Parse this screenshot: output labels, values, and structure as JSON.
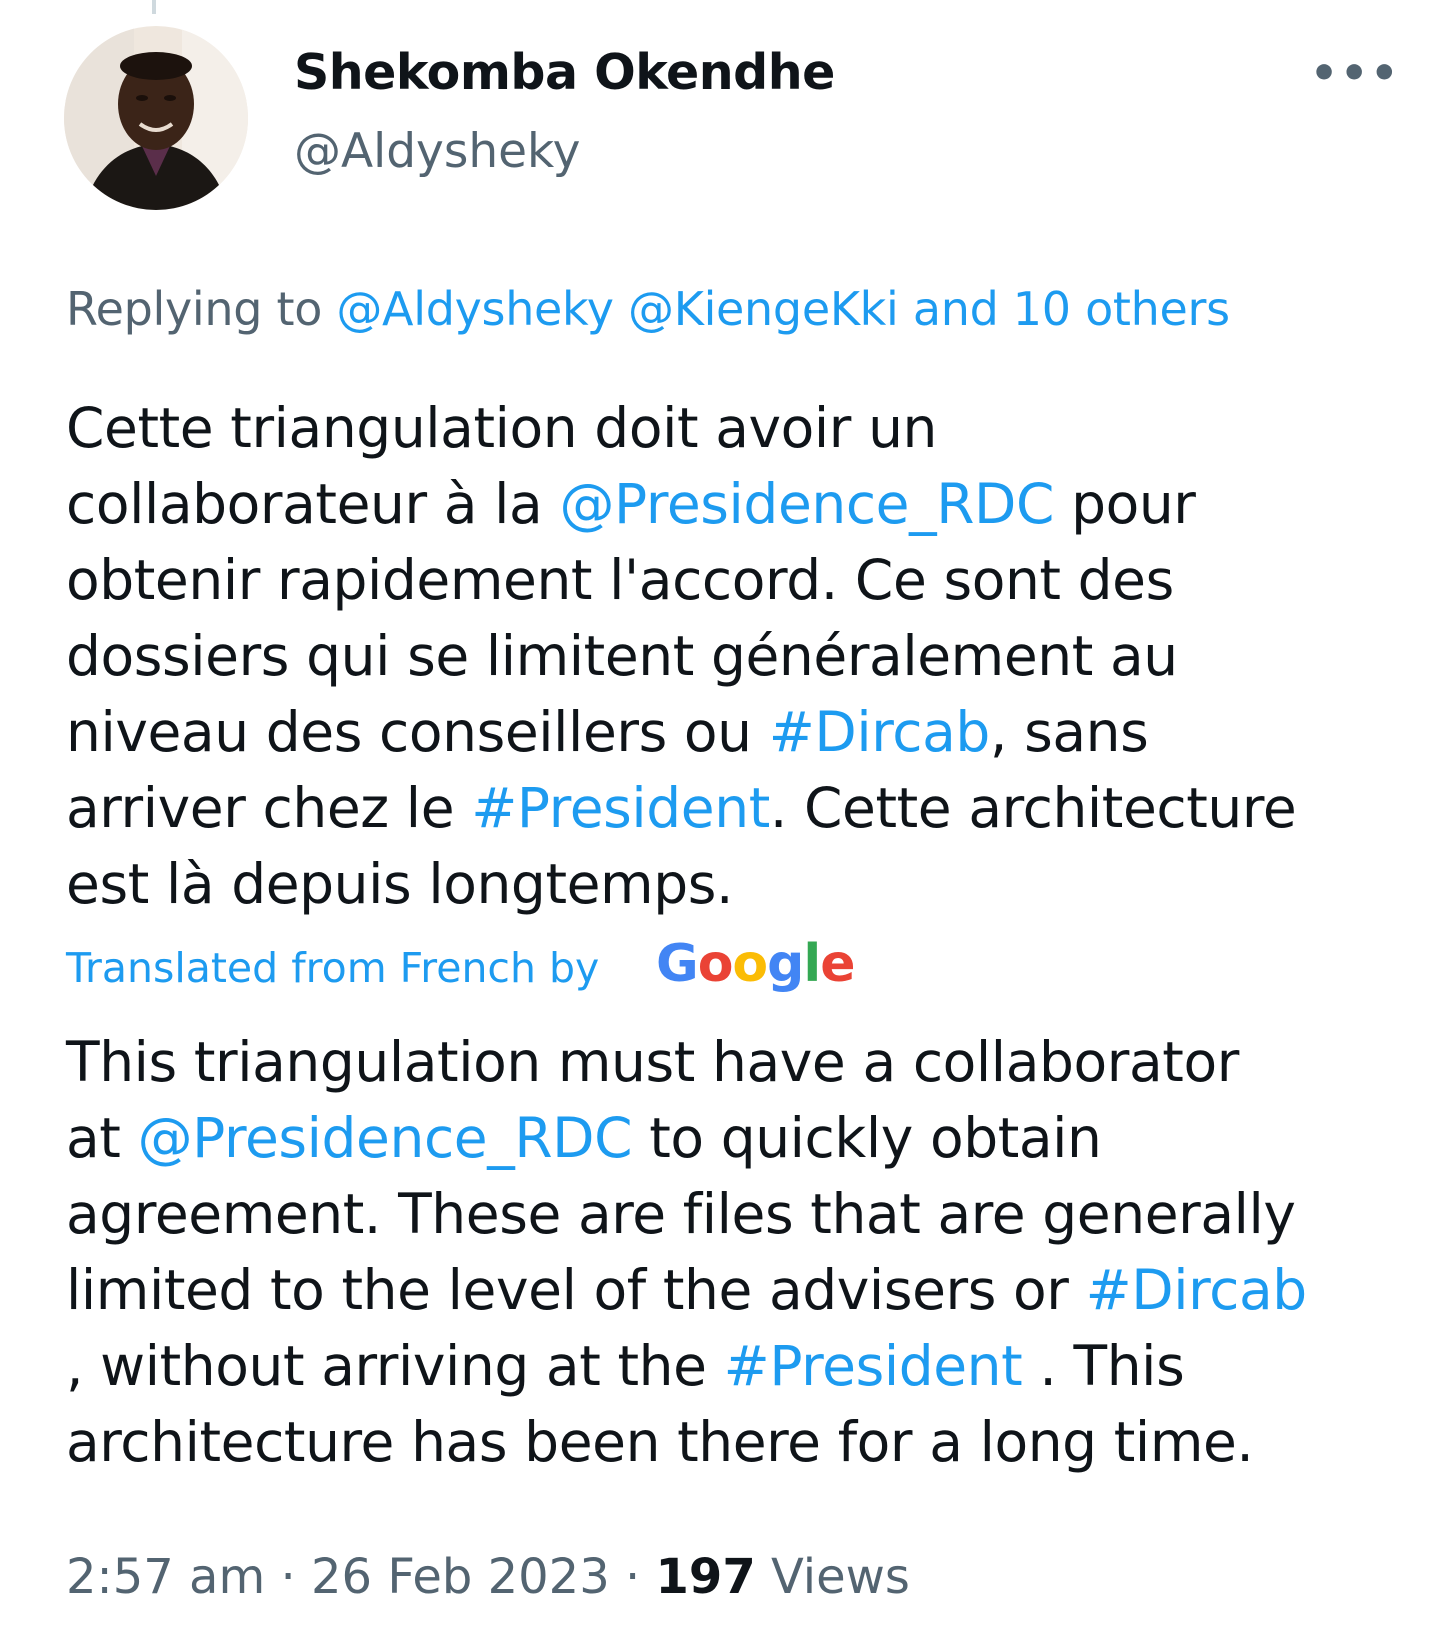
{
  "tweet": {
    "author_name": "Shekomba Okendhe",
    "author_handle": "@Aldysheky",
    "more_icon": "more-horizontal-icon",
    "replying": {
      "prefix": "Replying to ",
      "mention_1": "@Aldysheky",
      "mention_2": "@KiengeKki",
      "others": " and 10 others"
    },
    "original": {
      "l1": "Cette triangulation doit avoir un",
      "l2a": "collaborateur à la ",
      "l2b": "@Presidence_RDC",
      "l2c": " pour",
      "l3": "obtenir rapidement l'accord. Ce sont des",
      "l4": "dossiers qui se limitent généralement au",
      "l5a": "niveau des conseillers ou ",
      "l5b": "#Dircab",
      "l5c": ", sans",
      "l6a": "arriver chez le ",
      "l6b": "#President",
      "l6c": ". Cette architecture",
      "l7": "est là depuis longtemps."
    },
    "translated_label": "Translated from French by",
    "translator_logo": "Google",
    "translation": {
      "l1": "This triangulation must have a collaborator",
      "l2a": "at ",
      "l2b": "@Presidence_RDC",
      "l2c": " to quickly obtain",
      "l3": "agreement. These are files that are generally",
      "l4a": "limited to the level of the advisers or ",
      "l4b": "#Dircab",
      "l5a": ", without arriving at the ",
      "l5b": "#President",
      "l5c": " . This",
      "l6": "architecture has been there for a long time."
    },
    "time": "2:57 am",
    "separator": " · ",
    "date": "26 Feb 2023",
    "views_count": "197",
    "views_label": " Views"
  },
  "colors": {
    "link": "#1d9bf0",
    "secondary_text": "#536471",
    "primary_text": "#0f1419",
    "google_blue": "#4285f4",
    "google_red": "#ea4335",
    "google_yellow": "#fbbc05",
    "google_green": "#34a853"
  }
}
